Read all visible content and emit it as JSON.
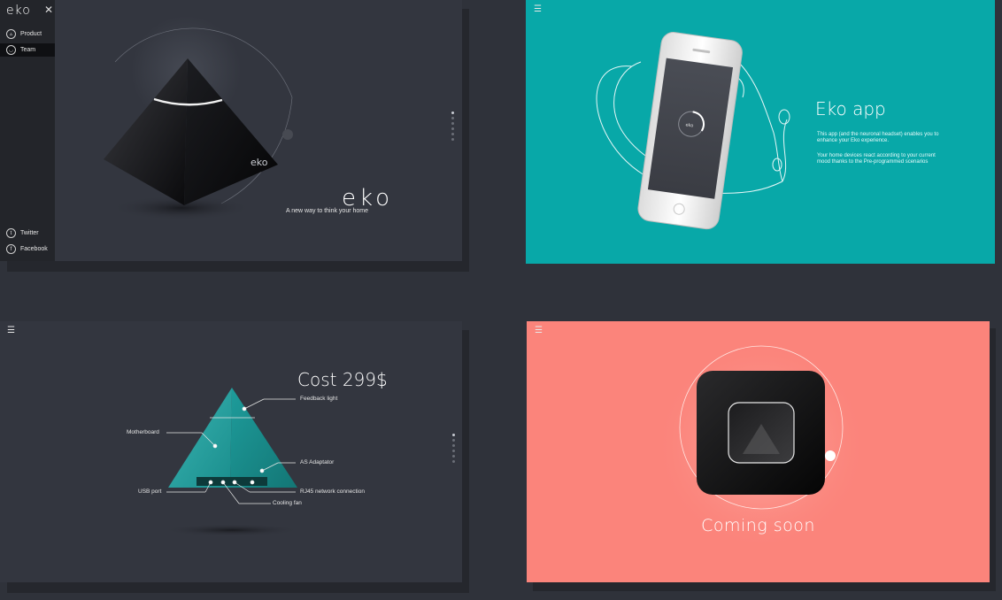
{
  "panel1": {
    "logo": "eko",
    "close_icon": "close-icon",
    "nav": [
      {
        "label": "Product",
        "icon": "triangle-icon"
      },
      {
        "label": "Team",
        "icon": "user-icon",
        "active": true
      }
    ],
    "social": [
      {
        "label": "Twitter",
        "icon": "twitter-icon"
      },
      {
        "label": "Facebook",
        "icon": "facebook-icon"
      }
    ],
    "brand_wordmark": "eko",
    "device_logo": "eko",
    "tagline": "A new way to think your home"
  },
  "panel2": {
    "title": "Eko app",
    "paragraph1": "This app (and the neuronal headset) enables you to enhance your Eko experience.",
    "paragraph2": "Your home devices react according to your current mood thanks to the Pre-programmed scenarios"
  },
  "panel3": {
    "price": "Cost 299$",
    "labels": {
      "feedback": "Feedback light",
      "motherboard": "Motherboard",
      "adaptator": "AS Adaptator",
      "usb": "USB port",
      "rj45": "RJ45 network connection",
      "fan": "Cooling fan"
    }
  },
  "panel4": {
    "coming_soon": "Coming soon"
  },
  "colors": {
    "teal": "#08a8a8",
    "coral": "#fb847b",
    "dark": "#33363f"
  }
}
